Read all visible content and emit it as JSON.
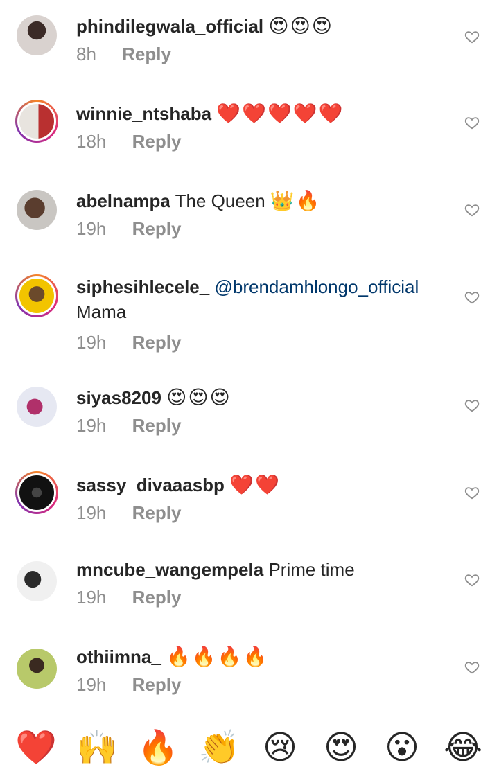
{
  "comments": [
    {
      "username": "phindilegwala_official",
      "text": "",
      "emoji": "😍😍😍",
      "time": "8h",
      "reply": "Reply",
      "avatar_ring": false,
      "avatar_colors": [
        "#d9d2cf",
        "#3b2a26"
      ]
    },
    {
      "username": "winnie_ntshaba",
      "text": "",
      "emoji": "❤️❤️❤️❤️❤️",
      "time": "18h",
      "reply": "Reply",
      "avatar_ring": true,
      "avatar_colors": [
        "#e8e4df",
        "#b93030"
      ]
    },
    {
      "username": "abelnampa",
      "text": "The Queen",
      "emoji": "👑🔥",
      "time": "19h",
      "reply": "Reply",
      "avatar_ring": false,
      "avatar_colors": [
        "#c9c6c2",
        "#5a3d2e"
      ]
    },
    {
      "username": "siphesihlecele_",
      "mention": "@brendamhlongo_official",
      "text": "Mama",
      "emoji": "",
      "time": "19h",
      "reply": "Reply",
      "avatar_ring": true,
      "avatar_colors": [
        "#f2c400",
        "#6b4a2b"
      ]
    },
    {
      "username": "siyas8209",
      "text": "",
      "emoji": "😍😍😍",
      "time": "19h",
      "reply": "Reply",
      "avatar_ring": false,
      "avatar_colors": [
        "#e6e8f2",
        "#b0306a"
      ]
    },
    {
      "username": "sassy_divaaasbp",
      "text": "",
      "emoji": "❤️❤️",
      "time": "19h",
      "reply": "Reply",
      "avatar_ring": true,
      "avatar_colors": [
        "#111111",
        "#444444"
      ]
    },
    {
      "username": "mncube_wangempela",
      "text": "Prime time",
      "emoji": "",
      "time": "19h",
      "reply": "Reply",
      "avatar_ring": false,
      "avatar_colors": [
        "#f0f0f0",
        "#2b2b2b"
      ]
    },
    {
      "username": "othiimna_",
      "text": "",
      "emoji": "🔥🔥🔥🔥",
      "time": "19h",
      "reply": "Reply",
      "avatar_ring": false,
      "avatar_colors": [
        "#b8c96a",
        "#3a2a20"
      ]
    }
  ],
  "reactions": [
    "❤️",
    "🙌",
    "🔥",
    "👏",
    "😢",
    "😍",
    "😮",
    "😂"
  ],
  "icons": {
    "like": "heart-outline-icon"
  },
  "colors": {
    "username": "#262626",
    "meta": "#8e8e8e",
    "mention": "#00376b",
    "divider": "#dbdbdb"
  }
}
